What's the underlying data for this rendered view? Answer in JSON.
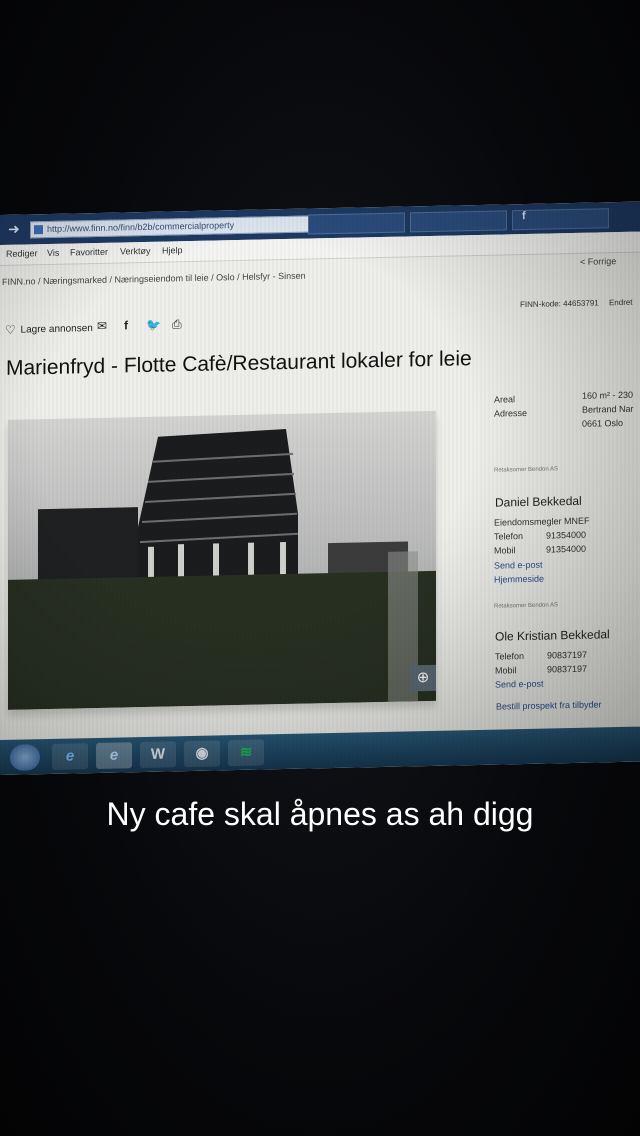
{
  "caption": "Ny cafe skal åpnes as ah digg",
  "browser": {
    "address": "http://www.finn.no/finn/b2b/commercialproperty",
    "menu": [
      "Rediger",
      "Vis",
      "Favoritter",
      "Verktøy",
      "Hjelp"
    ],
    "breadcrumb": "FINN.no / Næringsmarked / Næringseiendom til leie / Oslo / Helsfyr - Sinsen",
    "forrige": "< Forrige"
  },
  "listing": {
    "save_label": "Lagre annonsen",
    "finn_code": "FINN-kode: 44653791",
    "finn_extra": "Endret",
    "title": "Marienfryd - Flotte Cafè/Restaurant lokaler for leie",
    "facts": {
      "areal_label": "Areal",
      "areal_value": "160 m² - 230",
      "adresse_label": "Adresse",
      "adresse_line1": "Bertrand Nar",
      "adresse_line2": "0661 Oslo"
    },
    "agency_small": "Retaksomer Bendon AS",
    "agent1": {
      "name": "Daniel Bekkedal",
      "role": "Eiendomsmegler MNEF",
      "phone_label": "Telefon",
      "phone": "91354000",
      "mobile_label": "Mobil",
      "mobile": "91354000",
      "email": "Send e-post",
      "home": "Hjemmeside"
    },
    "agent2": {
      "name": "Ole Kristian Bekkedal",
      "phone_label": "Telefon",
      "phone": "90837197",
      "mobile_label": "Mobil",
      "mobile": "90837197",
      "email": "Send e-post",
      "prospekt": "Bestill prospekt fra tilbyder"
    }
  },
  "icons": {
    "heart": "♡",
    "mail": "✉",
    "facebook": "f",
    "twitter": "🐦",
    "print": "⎙",
    "zoom": "⊕",
    "ie": "e",
    "word": "W",
    "paint": "◉",
    "spotify": "≋",
    "fb_tab": "f"
  }
}
